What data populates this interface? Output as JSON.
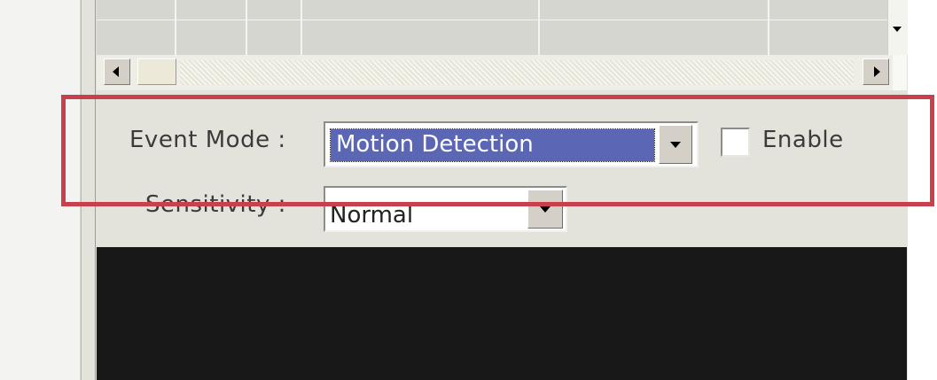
{
  "event_mode": {
    "label": "Event Mode :",
    "selected_value": "Motion Detection",
    "enable_label": "Enable",
    "enable_checked": false
  },
  "sensitivity": {
    "label": "Sensitivity :",
    "selected_value": "Normal"
  },
  "icons": {
    "dropdown": "chevron-down-icon",
    "scroll_left": "arrow-left-icon",
    "scroll_right": "arrow-right-icon",
    "scroll_down": "arrow-down-icon"
  },
  "colors": {
    "highlight_border": "#c9404d",
    "selection": "#5b67b4",
    "panel": "#e3e3dc",
    "preview": "#181818"
  }
}
